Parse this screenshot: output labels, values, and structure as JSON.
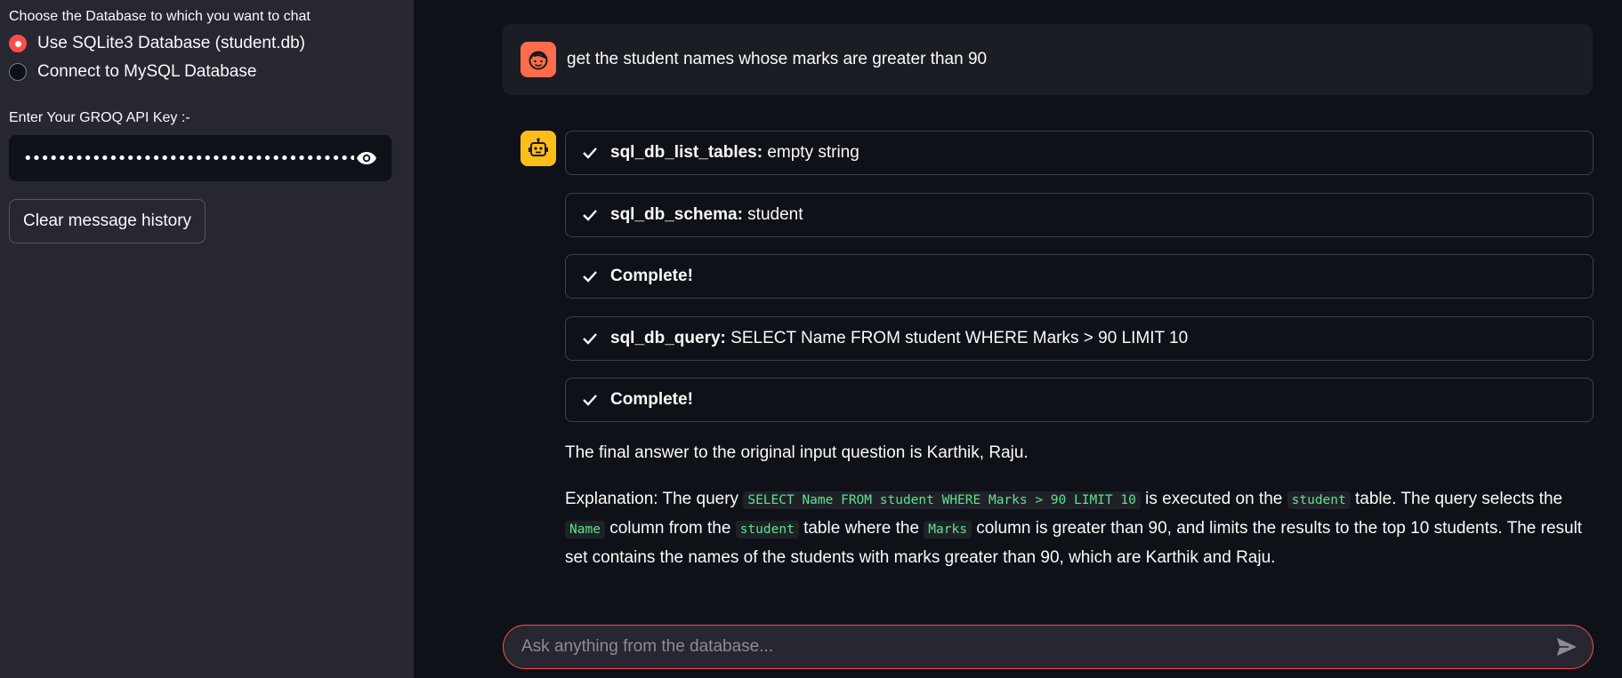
{
  "sidebar": {
    "db_choice_label": "Choose the Database to which you want to chat",
    "options": [
      {
        "label": "Use SQLite3 Database (student.db)",
        "selected": true
      },
      {
        "label": "Connect to MySQL Database",
        "selected": false
      }
    ],
    "api_key_label": "Enter Your GROQ API Key :-",
    "api_key_value": "••••••••••••••••••••••••••••••••••••••••••••••••••••••",
    "clear_button": "Clear message history"
  },
  "chat": {
    "user_message": "get the student names whose marks are greater than 90",
    "steps": [
      {
        "tool": "sql_db_list_tables:",
        "detail": " empty string"
      },
      {
        "tool": "sql_db_schema:",
        "detail": " student"
      },
      {
        "tool": "Complete!",
        "detail": ""
      },
      {
        "tool": "sql_db_query:",
        "detail": " SELECT Name FROM student WHERE Marks > 90 LIMIT 10"
      },
      {
        "tool": "Complete!",
        "detail": ""
      }
    ],
    "final_answer": "The final answer to the original input question is Karthik, Raju.",
    "explanation": {
      "p1": "Explanation: The query ",
      "code1": "SELECT Name FROM student WHERE Marks > 90 LIMIT 10",
      "p2": " is executed on the ",
      "code2": "student",
      "p3": " table. The query selects the ",
      "code3": "Name",
      "p4": " column from the ",
      "code4": "student",
      "p5": " table where the ",
      "code5": "Marks",
      "p6": " column is greater than 90, and limits the results to the top 10 students. The result set contains the names of the students with marks greater than 90, which are Karthik and Raju."
    },
    "input_placeholder": "Ask anything from the database..."
  },
  "colors": {
    "accent": "#ff4b4b",
    "sidebar_bg": "#262730",
    "main_bg": "#0e1117",
    "code_green": "#5ce488",
    "user_avatar": "#ff6c4c",
    "bot_avatar": "#ffbd1a"
  },
  "icons": {
    "eye": "eye-icon",
    "user_avatar": "user-face-icon",
    "bot_avatar": "robot-icon",
    "check": "check-icon",
    "send": "send-icon"
  }
}
